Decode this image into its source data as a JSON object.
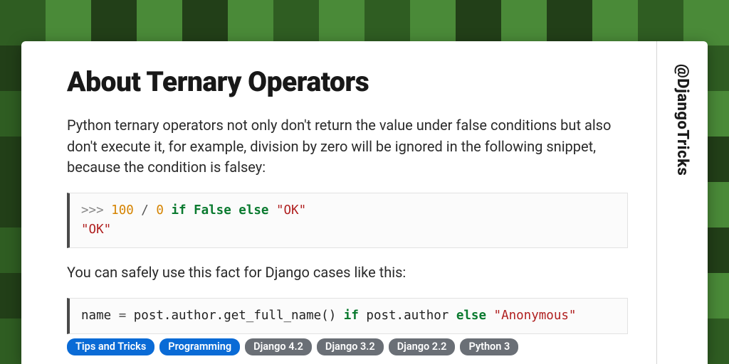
{
  "title": "About Ternary Operators",
  "author_handle": "@DjangoTricks",
  "paragraphs": {
    "intro": "Python ternary operators not only don't return the value under false conditions but also don't execute it, for example, division by zero will be ignored in the following snippet, because the condition is falsey:",
    "followup": "You can safely use this fact for Django cases like this:"
  },
  "code1": {
    "prompt": ">>> ",
    "n1": "100",
    "op_div": " / ",
    "n2": "0",
    "kw_if": " if ",
    "kw_false": "False",
    "kw_else": " else ",
    "str_ok": "\"OK\"",
    "out": "\"OK\""
  },
  "code2": {
    "lhs": "name ",
    "eq": "= ",
    "call": "post.author.get_full_name()",
    "kw_if": " if ",
    "cond": "post.author",
    "kw_else": " else ",
    "str_anon": "\"Anonymous\""
  },
  "tags": [
    {
      "label": "Tips and Tricks",
      "kind": "primary"
    },
    {
      "label": "Programming",
      "kind": "primary"
    },
    {
      "label": "Django 4.2",
      "kind": "muted"
    },
    {
      "label": "Django 3.2",
      "kind": "muted"
    },
    {
      "label": "Django 2.2",
      "kind": "muted"
    },
    {
      "label": "Python 3",
      "kind": "muted"
    }
  ]
}
